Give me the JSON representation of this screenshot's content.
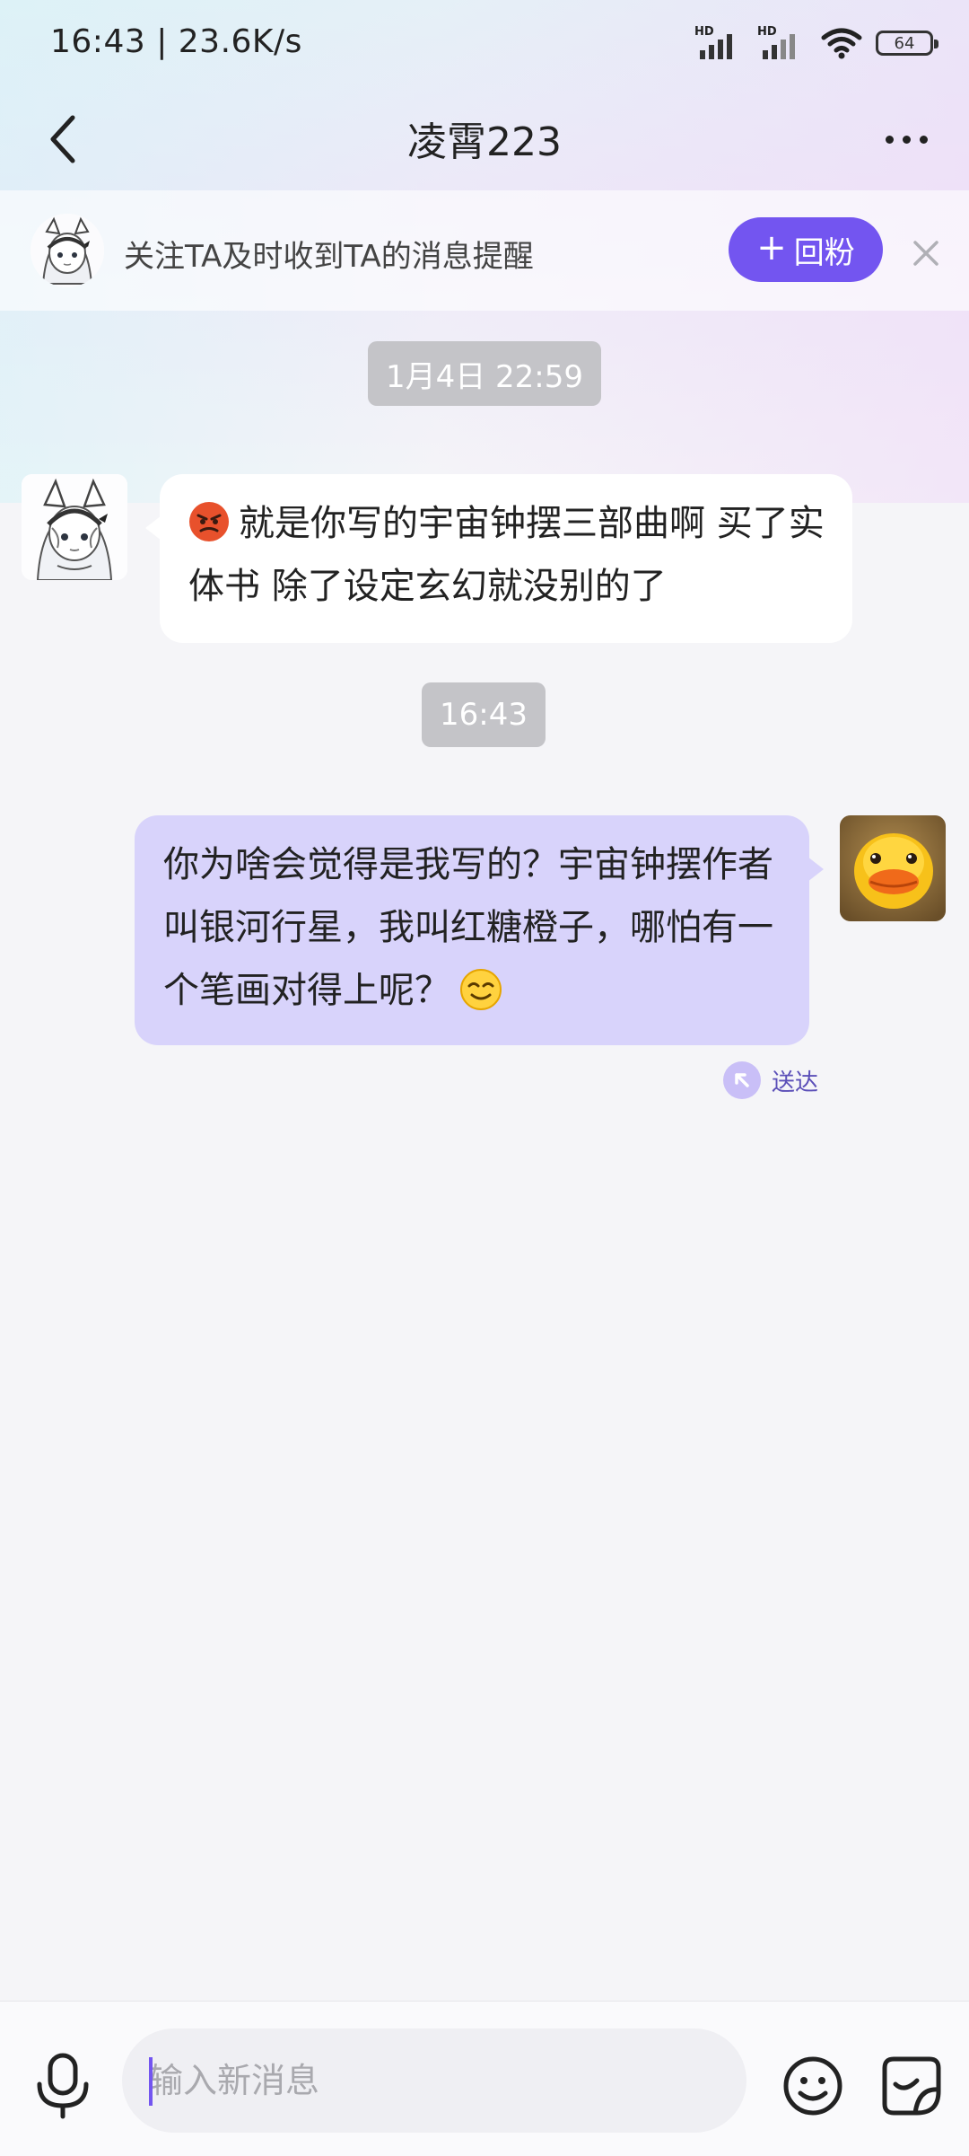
{
  "status_bar": {
    "time": "16:43 | 23.6K/s",
    "sim1_tag": "HD",
    "sim2_tag": "HD",
    "battery": "64"
  },
  "nav": {
    "title": "凌霄223"
  },
  "follow_banner": {
    "text": "关注TA及时收到TA的消息提醒",
    "button_plus": "+",
    "button_label": "回粉"
  },
  "chat": {
    "timestamp_1": "1月4日 22:59",
    "message_1": "就是你写的宇宙钟摆三部曲啊 买了实体书 除了设定玄幻就没别的了",
    "timestamp_2": "16:43",
    "message_2": "你为啥会觉得是我写的？宇宙钟摆作者叫银河行星，我叫红糖橙子，哪怕有一个笔画对得上呢？",
    "message_2_status": "送达"
  },
  "input": {
    "placeholder": "输入新消息"
  },
  "colors": {
    "accent": "#7355f0",
    "outgoing_bubble": "#d8d3fb",
    "timestamp_pill": "#c4c4c8"
  }
}
